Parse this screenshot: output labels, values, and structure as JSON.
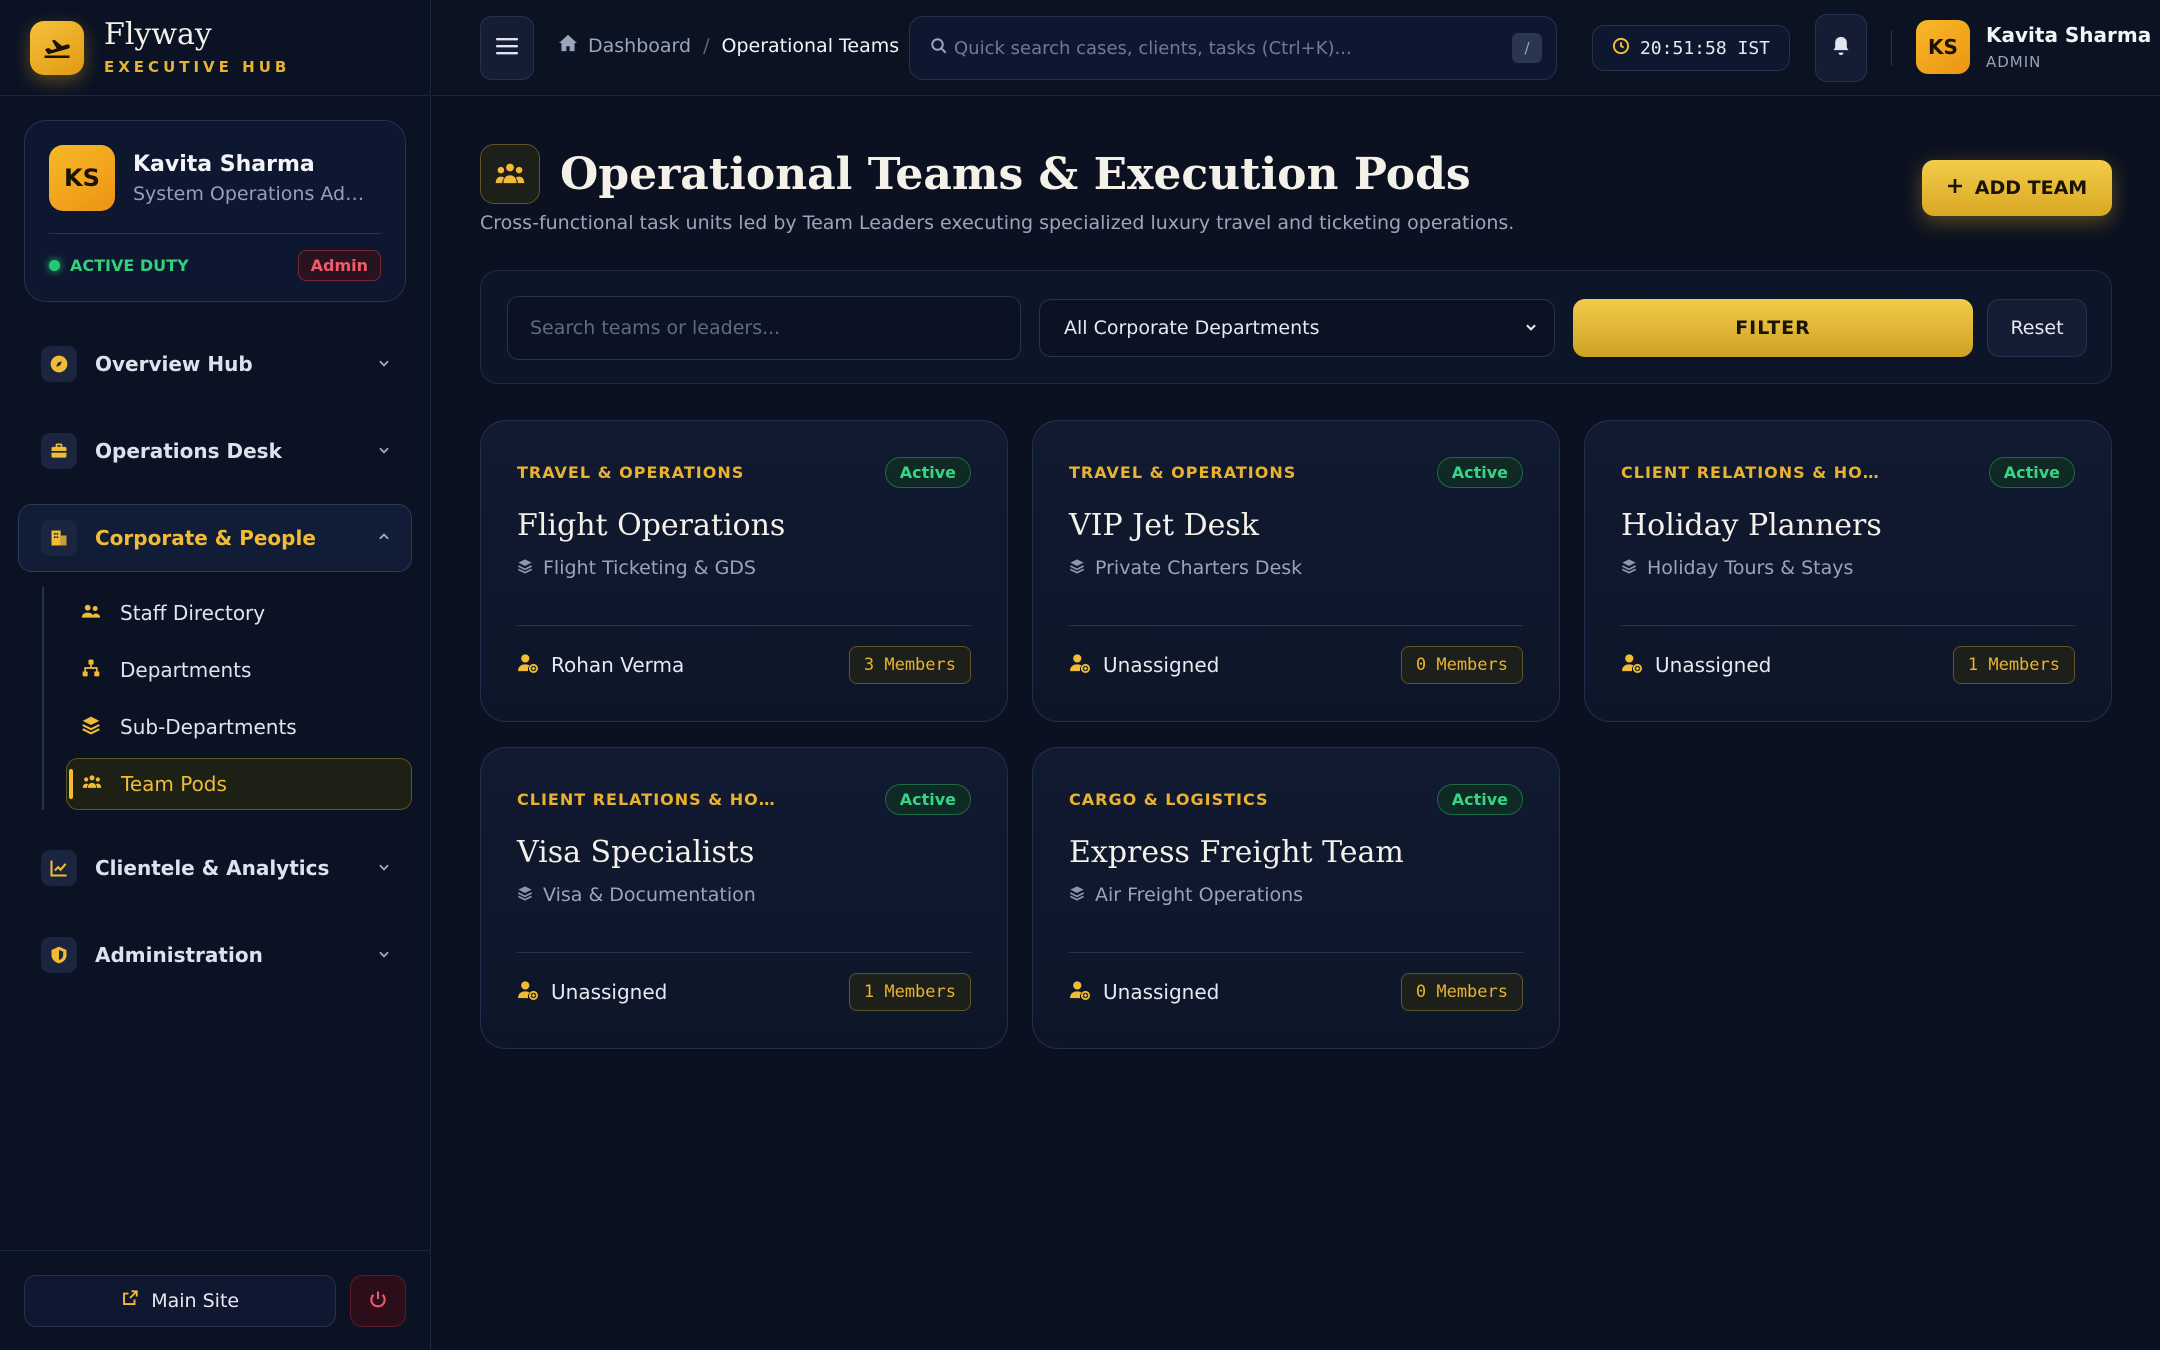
{
  "brand": {
    "name": "Flyway",
    "subtitle": "EXECUTIVE HUB"
  },
  "profile": {
    "initials": "KS",
    "name": "Kavita Sharma",
    "role": "System Operations Administrator",
    "duty_status": "ACTIVE DUTY",
    "badge": "Admin"
  },
  "nav": {
    "overview": "Overview Hub",
    "operations": "Operations Desk",
    "corporate": "Corporate & People",
    "sub": {
      "staff": "Staff Directory",
      "departments": "Departments",
      "subdepartments": "Sub-Departments",
      "teampods": "Team Pods"
    },
    "clientele": "Clientele & Analytics",
    "administration": "Administration"
  },
  "footer": {
    "main_site": "Main Site"
  },
  "topbar": {
    "breadcrumb_home": "Dashboard",
    "breadcrumb_sep": "/",
    "breadcrumb_current": "Operational Teams",
    "search_placeholder": "Quick search cases, clients, tasks (Ctrl+K)...",
    "search_shortcut": "/",
    "clock": "20:51:58 IST",
    "user_initials": "KS",
    "user_name": "Kavita Sharma",
    "user_role": "ADMIN"
  },
  "page": {
    "title": "Operational Teams & Execution Pods",
    "subtitle": "Cross-functional task units led by Team Leaders executing specialized luxury travel and ticketing operations.",
    "add_button": "ADD TEAM"
  },
  "filters": {
    "search_placeholder": "Search teams or leaders...",
    "department_selected": "All Corporate Departments",
    "filter_button": "FILTER",
    "reset_button": "Reset"
  },
  "teams": [
    {
      "department": "TRAVEL & OPERATIONS",
      "status": "Active",
      "name": "Flight Operations",
      "sub_department": "Flight Ticketing & GDS",
      "leader": "Rohan Verma",
      "members": "3 Members"
    },
    {
      "department": "TRAVEL & OPERATIONS",
      "status": "Active",
      "name": "VIP Jet Desk",
      "sub_department": "Private Charters Desk",
      "leader": "Unassigned",
      "members": "0 Members"
    },
    {
      "department": "CLIENT RELATIONS & HOLIDAYS",
      "status": "Active",
      "name": "Holiday Planners",
      "sub_department": "Holiday Tours & Stays",
      "leader": "Unassigned",
      "members": "1 Members"
    },
    {
      "department": "CLIENT RELATIONS & HOLIDAYS",
      "status": "Active",
      "name": "Visa Specialists",
      "sub_department": "Visa & Documentation",
      "leader": "Unassigned",
      "members": "1 Members"
    },
    {
      "department": "CARGO & LOGISTICS",
      "status": "Active",
      "name": "Express Freight Team",
      "sub_department": "Air Freight Operations",
      "leader": "Unassigned",
      "members": "0 Members"
    }
  ],
  "colors": {
    "accent": "#f1bb35",
    "background": "#0b1120",
    "success": "#35d487",
    "danger": "#f05b6b"
  }
}
